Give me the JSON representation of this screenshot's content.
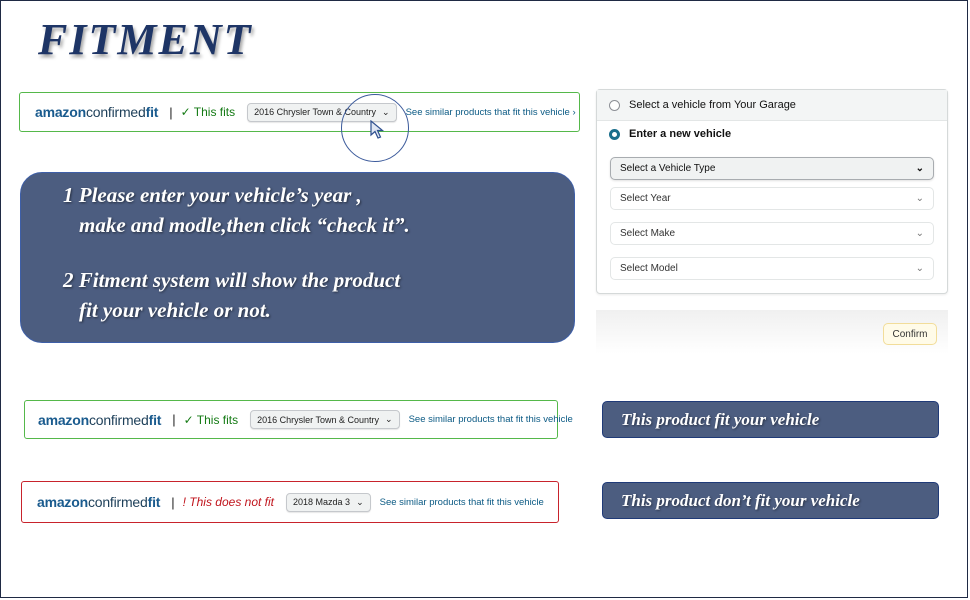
{
  "title": "FITMENT",
  "brand": {
    "part1": "amazon",
    "part2": "confirmed",
    "part3": "fit"
  },
  "top_bar": {
    "status": "✓ This fits",
    "vehicle": "2016 Chrysler Town & Country",
    "link": "See similar products that fit this vehicle ›"
  },
  "fit_bar": {
    "status": "✓ This fits",
    "vehicle": "2016 Chrysler Town & Country",
    "link": "See similar products that fit this vehicle"
  },
  "nofit_bar": {
    "status": "! This does not fit",
    "vehicle": "2018 Mazda 3",
    "link": "See similar products that fit this vehicle"
  },
  "instructions": {
    "line1": "1 Please enter your vehicle’s year ,",
    "line2": "make and modle,then click “check it”.",
    "line3": "2 Fitment system will show the product",
    "line4": "fit your vehicle or not."
  },
  "panel": {
    "garage_option": "Select a vehicle from Your Garage",
    "new_option": "Enter a new vehicle",
    "vehicle_type": "Select a Vehicle Type",
    "year": "Select Year",
    "make": "Select Make",
    "model": "Select Model",
    "confirm": "Confirm"
  },
  "results": {
    "fit": "This product fit your vehicle",
    "nofit": "This product don’t fit your vehicle"
  },
  "colors": {
    "accent": "#1e3566",
    "bubble": "#4c5d80",
    "fit_green": "#147a14",
    "nofit_red": "#c0141c"
  },
  "icons": {
    "check": "check-icon",
    "chevron": "chevron-down-icon",
    "cursor": "cursor-arrow-icon"
  }
}
